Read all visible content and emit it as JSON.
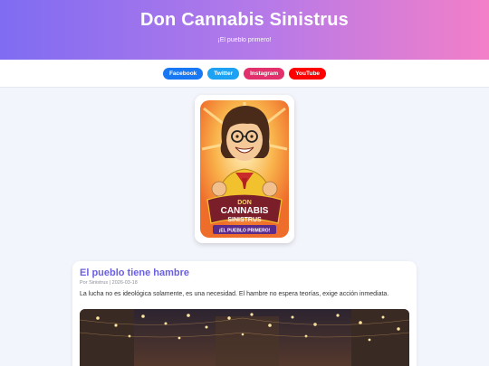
{
  "site": {
    "title": "Don Cannabis Sinistrus",
    "tagline": "¡El pueblo primero!"
  },
  "social": [
    {
      "label": "Facebook",
      "color": "#1877f2"
    },
    {
      "label": "Twitter",
      "color": "#1da1f2"
    },
    {
      "label": "Instagram",
      "color": "#e1306c"
    },
    {
      "label": "YouTube",
      "color": "#ff0000"
    }
  ],
  "avatar": {
    "badge_line1": "DON",
    "badge_line2": "CANNABIS",
    "badge_line3": "SINISTRUS",
    "ribbon": "¡EL PUEBLO PRIMERO!"
  },
  "post": {
    "title": "El pueblo tiene hambre",
    "meta": "Por Sinistrus | 2026-03-18",
    "excerpt": "La lucha no es ideológica solamente, es una necesidad. El hambre no espera teorías, exige acción inmediata."
  }
}
